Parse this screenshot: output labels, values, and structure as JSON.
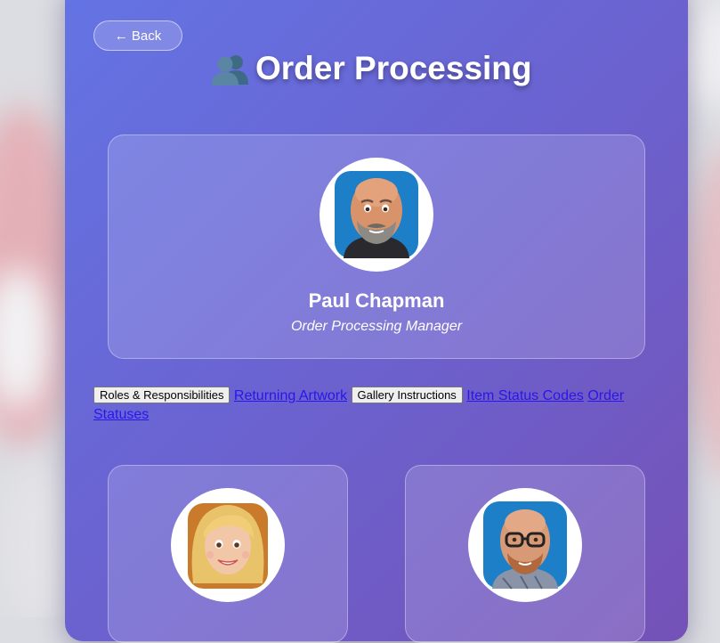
{
  "back_label": "← Back",
  "page": {
    "title": "Order Processing",
    "title_icon": "busts-in-silhouette-icon"
  },
  "manager": {
    "name": "Paul Chapman",
    "role": "Order Processing Manager",
    "avatar": "bald-man-avatar"
  },
  "nav": {
    "items": [
      {
        "label": "Roles & Responsibilities",
        "kind": "button"
      },
      {
        "label": "Returning Artwork",
        "kind": "link"
      },
      {
        "label": "Gallery Instructions",
        "kind": "button"
      },
      {
        "label": "Item Status Codes",
        "kind": "link"
      },
      {
        "label": "Order Statuses",
        "kind": "link"
      }
    ]
  },
  "team": [
    {
      "avatar": "blonde-woman-avatar"
    },
    {
      "avatar": "bald-man-glasses-avatar"
    }
  ],
  "colors": {
    "panel_start": "#6474e4",
    "panel_end": "#7552b7",
    "link": "#2a16ea"
  }
}
